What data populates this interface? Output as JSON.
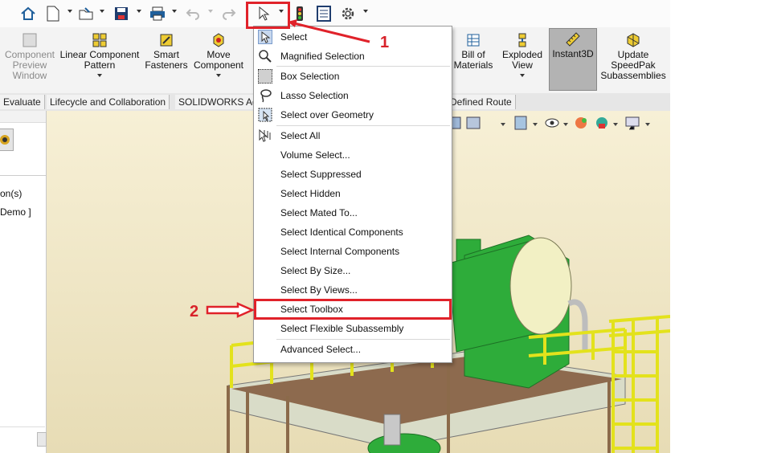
{
  "ribbon": {
    "buttons": [
      {
        "id": "preview",
        "label": "Component Preview Window",
        "disabled": true
      },
      {
        "id": "pattern",
        "label": "Linear Component Pattern"
      },
      {
        "id": "fasteners",
        "label": "Smart Fasteners"
      },
      {
        "id": "move",
        "label": "Move Component"
      },
      {
        "id": "bom",
        "label": "Bill of Materials"
      },
      {
        "id": "exploded",
        "label": "Exploded View"
      },
      {
        "id": "instant3d",
        "label": "Instant3D",
        "active": true
      },
      {
        "id": "speedpak",
        "label": "Update SpeedPak Subassemblies"
      }
    ]
  },
  "tabs": [
    "Evaluate",
    "Lifecycle and Collaboration",
    "SOLIDWORKS Ad",
    "Defined Route"
  ],
  "tree": {
    "lines": [
      "on(s)",
      "Demo ]"
    ]
  },
  "menu": {
    "items": [
      {
        "label": "Select",
        "icon": "arrow-icon"
      },
      {
        "label": "Magnified Selection",
        "icon": "magnifier-icon"
      },
      {
        "label": "Box Selection",
        "icon": "box-select-icon"
      },
      {
        "label": "Lasso Selection",
        "icon": "lasso-icon"
      },
      {
        "label": "Select over Geometry",
        "icon": "geometry-select-icon"
      },
      {
        "label": "Select All",
        "icon": "select-all-icon"
      },
      {
        "label": "Volume Select..."
      },
      {
        "label": "Select Suppressed"
      },
      {
        "label": "Select Hidden"
      },
      {
        "label": "Select Mated To..."
      },
      {
        "label": "Select Identical Components"
      },
      {
        "label": "Select Internal Components"
      },
      {
        "label": "Select By Size..."
      },
      {
        "label": "Select By Views..."
      },
      {
        "label": "Select Toolbox",
        "highlighted": true
      },
      {
        "label": "Select Flexible Subassembly"
      },
      {
        "label": "Advanced Select..."
      }
    ]
  },
  "annotations": {
    "step1": "1",
    "step2": "2"
  },
  "colors": {
    "annotation": "#e0222a",
    "platform": "#e3e21c",
    "tank": "#2eac3a",
    "instant3d_bg": "#b3b3b3"
  }
}
